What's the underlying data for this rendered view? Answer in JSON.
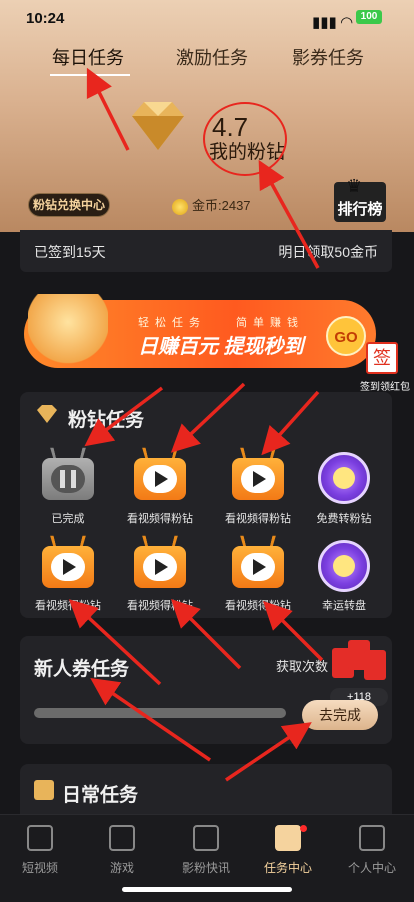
{
  "status_bar": {
    "time": "10:24",
    "battery": "100"
  },
  "tabs": [
    {
      "label": "每日任务",
      "active": true
    },
    {
      "label": "激励任务",
      "active": false
    },
    {
      "label": "影券任务",
      "active": false
    }
  ],
  "rating": {
    "value": "4.7",
    "label": "我的粉钻"
  },
  "header_actions": {
    "exchange_label": "粉钻兑换中心",
    "coins_label": "金币:2437",
    "rank_label": "排行榜"
  },
  "checkin": {
    "left_text": "已签到15天",
    "right_text": "明日领取50金币"
  },
  "promo": {
    "small_left": "轻松任务",
    "small_right": "简单赚钱",
    "main": "日赚百元  提现秒到",
    "go": "GO",
    "badge": "签",
    "badge_label": "签到领红包"
  },
  "diamond_tasks": {
    "title": "粉钻任务",
    "items": [
      {
        "label": "已完成",
        "icon": "tv-pause-icon",
        "done": true
      },
      {
        "label": "看视频得粉钻",
        "icon": "tv-play-icon",
        "done": false
      },
      {
        "label": "看视频得粉钻",
        "icon": "tv-play-icon",
        "done": false
      },
      {
        "label": "免费转粉钻",
        "icon": "wheel-icon",
        "done": false
      },
      {
        "label": "看视频得粉钻",
        "icon": "tv-play-icon",
        "done": false
      },
      {
        "label": "看视频得粉钻",
        "icon": "tv-play-icon",
        "done": false
      },
      {
        "label": "看视频得粉钻",
        "icon": "tv-play-icon",
        "done": false
      },
      {
        "label": "幸运转盘",
        "icon": "wheel-icon",
        "done": false
      }
    ]
  },
  "newcomer_tasks": {
    "title": "新人券任务",
    "right_text": "获取次数",
    "progress": 0,
    "button": "去完成",
    "reward": "+118"
  },
  "daily_tasks": {
    "title": "日常任务"
  },
  "bottom_nav": [
    {
      "label": "短视频",
      "icon": "short-video-icon",
      "active": false
    },
    {
      "label": "游戏",
      "icon": "gamepad-icon",
      "active": false
    },
    {
      "label": "影粉快讯",
      "icon": "news-icon",
      "active": false
    },
    {
      "label": "任务中心",
      "icon": "task-center-icon",
      "active": true
    },
    {
      "label": "个人中心",
      "icon": "profile-icon",
      "active": false
    }
  ],
  "colors": {
    "accent": "#f5d39e",
    "annotation": "#e8261e",
    "promo": "#ff6a22"
  }
}
